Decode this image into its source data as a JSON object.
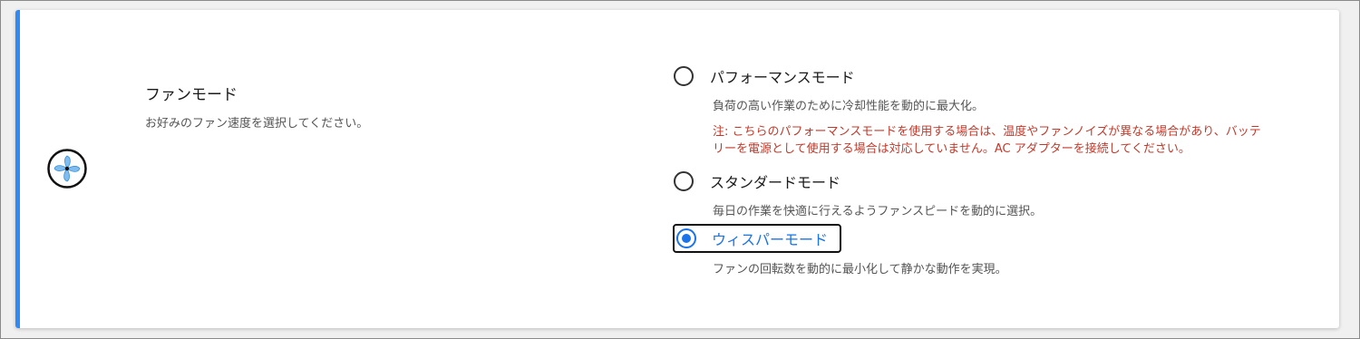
{
  "setting": {
    "icon": "fan-icon",
    "title": "ファンモード",
    "description": "お好みのファン速度を選択してください。"
  },
  "options": [
    {
      "label": "パフォーマンスモード",
      "description": "負荷の高い作業のために冷却性能を動的に最大化。",
      "note": "注: こちらのパフォーマンスモードを使用する場合は、温度やファンノイズが異なる場合があり、バッテリーを電源として使用する場合は対応していません。AC アダプターを接続してください。",
      "selected": false
    },
    {
      "label": "スタンダードモード",
      "description": "毎日の作業を快適に行えるようファンスピードを動的に選択。",
      "selected": false
    },
    {
      "label": "ウィスパーモード",
      "description": "ファンの回転数を動的に最小化して静かな動作を実現。",
      "selected": true
    }
  ],
  "colors": {
    "accent": "#2f8af5",
    "selected": "#1a73e8",
    "warning": "#c0392b"
  }
}
